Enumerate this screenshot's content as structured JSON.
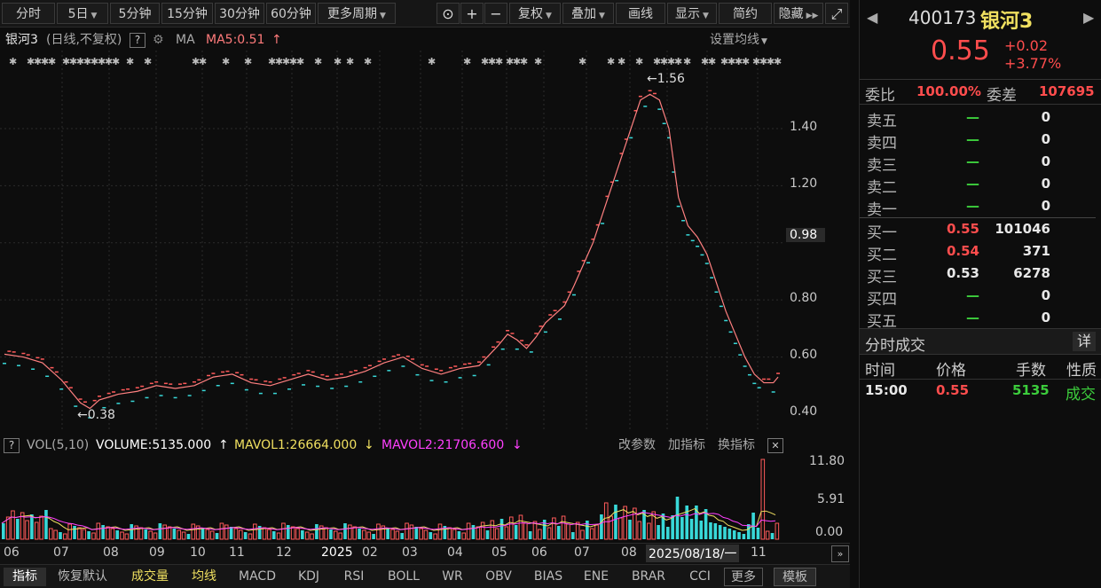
{
  "toolbar": {
    "periods": [
      "分时",
      "5日",
      "5分钟",
      "15分钟",
      "30分钟",
      "60分钟",
      "更多周期"
    ],
    "fuquan": "复权",
    "diejia": "叠加",
    "huaxian": "画线",
    "xianshi": "显示",
    "jianyue": "简约",
    "yincang": "隐藏"
  },
  "info": {
    "name": "银河3",
    "mode": "(日线,不复权)",
    "help": "?",
    "ma_label": "MA",
    "ma5": "MA5:0.51",
    "ma_arrow": "↑",
    "set_ma": "设置均线"
  },
  "price_axis": [
    "1.40",
    "1.20",
    "0.98",
    "0.80",
    "0.60",
    "0.40"
  ],
  "markers": {
    "high": "1.56",
    "low": "0.38"
  },
  "vol": {
    "help": "?",
    "label": "VOL(5,10)",
    "volume": "VOLUME:5135.000",
    "v_arrow": "↑",
    "mavol1": "MAVOL1:26664.000",
    "m1_arrow": "↓",
    "mavol2": "MAVOL2:21706.600",
    "m2_arrow": "↓",
    "gaicanshu": "改参数",
    "jiazhibiao": "加指标",
    "huanzhibiao": "换指标",
    "close": "✕",
    "axis": [
      "11.80",
      "5.91",
      "0.00"
    ]
  },
  "date_axis": [
    "06",
    "07",
    "08",
    "09",
    "10",
    "11",
    "12",
    "2025",
    "02",
    "03",
    "04",
    "05",
    "06",
    "07",
    "08",
    "2025/08/18/一",
    "11"
  ],
  "bottom": [
    "指标",
    "恢复默认",
    "成交量",
    "均线",
    "MACD",
    "KDJ",
    "RSI",
    "BOLL",
    "WR",
    "OBV",
    "BIAS",
    "ENE",
    "BRAR",
    "CCI",
    "更多",
    "模板"
  ],
  "quote": {
    "code": "400173",
    "name": "银河3",
    "price": "0.55",
    "change": "+0.02",
    "pct": "+3.77%",
    "weibi_lbl": "委比",
    "weibi": "100.00%",
    "weicha_lbl": "委差",
    "weicha": "107695"
  },
  "orderbook": [
    {
      "label": "卖五",
      "price": "—",
      "vol": "0"
    },
    {
      "label": "卖四",
      "price": "—",
      "vol": "0"
    },
    {
      "label": "卖三",
      "price": "—",
      "vol": "0"
    },
    {
      "label": "卖二",
      "price": "—",
      "vol": "0"
    },
    {
      "label": "卖一",
      "price": "—",
      "vol": "0"
    },
    {
      "label": "买一",
      "price": "0.55",
      "vol": "101046"
    },
    {
      "label": "买二",
      "price": "0.54",
      "vol": "371"
    },
    {
      "label": "买三",
      "price": "0.53",
      "vol": "6278"
    },
    {
      "label": "买四",
      "price": "—",
      "vol": "0"
    },
    {
      "label": "买五",
      "price": "—",
      "vol": "0"
    }
  ],
  "trades": {
    "title": "分时成交",
    "detail": "详",
    "headers": [
      "时间",
      "价格",
      "手数",
      "性质"
    ],
    "rows": [
      {
        "time": "15:00",
        "price": "0.55",
        "vol": "5135",
        "type": "成交"
      }
    ]
  },
  "chart_data": {
    "type": "candlestick",
    "ylim": [
      0.4,
      1.56
    ],
    "ma5_path": [
      [
        0,
        0.61
      ],
      [
        4,
        0.6
      ],
      [
        8,
        0.58
      ],
      [
        12,
        0.52
      ],
      [
        16,
        0.44
      ],
      [
        18,
        0.42
      ],
      [
        20,
        0.45
      ],
      [
        24,
        0.47
      ],
      [
        28,
        0.48
      ],
      [
        32,
        0.5
      ],
      [
        36,
        0.49
      ],
      [
        40,
        0.5
      ],
      [
        44,
        0.53
      ],
      [
        48,
        0.54
      ],
      [
        52,
        0.51
      ],
      [
        56,
        0.5
      ],
      [
        60,
        0.52
      ],
      [
        64,
        0.54
      ],
      [
        68,
        0.52
      ],
      [
        72,
        0.53
      ],
      [
        76,
        0.55
      ],
      [
        80,
        0.58
      ],
      [
        84,
        0.6
      ],
      [
        88,
        0.56
      ],
      [
        92,
        0.54
      ],
      [
        96,
        0.56
      ],
      [
        100,
        0.57
      ],
      [
        104,
        0.64
      ],
      [
        106,
        0.68
      ],
      [
        108,
        0.66
      ],
      [
        110,
        0.63
      ],
      [
        112,
        0.67
      ],
      [
        114,
        0.72
      ],
      [
        116,
        0.75
      ],
      [
        118,
        0.78
      ],
      [
        120,
        0.85
      ],
      [
        124,
        1.0
      ],
      [
        128,
        1.2
      ],
      [
        132,
        1.4
      ],
      [
        134,
        1.5
      ],
      [
        136,
        1.52
      ],
      [
        138,
        1.5
      ],
      [
        140,
        1.4
      ],
      [
        142,
        1.16
      ],
      [
        144,
        1.06
      ],
      [
        146,
        1.02
      ],
      [
        148,
        0.96
      ],
      [
        150,
        0.86
      ],
      [
        152,
        0.76
      ],
      [
        154,
        0.68
      ],
      [
        156,
        0.6
      ],
      [
        158,
        0.54
      ],
      [
        160,
        0.51
      ],
      [
        162,
        0.51
      ],
      [
        163,
        0.53
      ]
    ]
  }
}
